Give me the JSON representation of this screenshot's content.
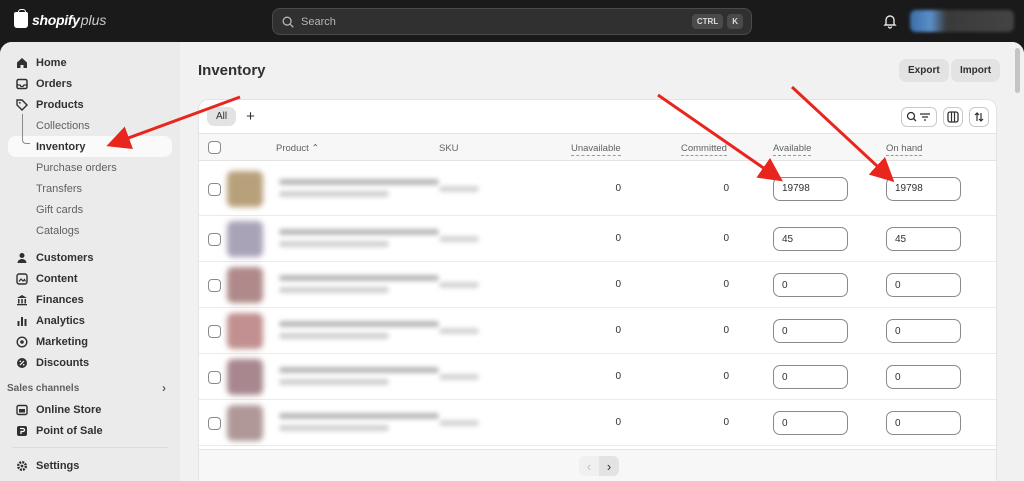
{
  "brand": {
    "name": "shopify",
    "suffix": "plus"
  },
  "search": {
    "placeholder": "Search",
    "shortcut": [
      "CTRL",
      "K"
    ]
  },
  "sidebar": {
    "items": [
      {
        "label": "Home",
        "icon": "home-icon"
      },
      {
        "label": "Orders",
        "icon": "inbox-icon"
      },
      {
        "label": "Products",
        "icon": "tag-icon"
      }
    ],
    "product_subitems": [
      "Collections",
      "Inventory",
      "Purchase orders",
      "Transfers",
      "Gift cards",
      "Catalogs"
    ],
    "active_subitem": "Inventory",
    "items2": [
      {
        "label": "Customers",
        "icon": "person-icon"
      },
      {
        "label": "Content",
        "icon": "content-icon"
      },
      {
        "label": "Finances",
        "icon": "bank-icon"
      },
      {
        "label": "Analytics",
        "icon": "chart-icon"
      },
      {
        "label": "Marketing",
        "icon": "target-icon"
      },
      {
        "label": "Discounts",
        "icon": "discount-icon"
      }
    ],
    "sales_channels_label": "Sales channels",
    "channels": [
      {
        "label": "Online Store",
        "icon": "store-icon"
      },
      {
        "label": "Point of Sale",
        "icon": "pos-icon"
      }
    ],
    "settings_label": "Settings"
  },
  "page": {
    "title": "Inventory",
    "export_label": "Export",
    "import_label": "Import"
  },
  "tabs": {
    "all_label": "All",
    "add_label": "+"
  },
  "table": {
    "headers": {
      "product": "Product",
      "sku": "SKU",
      "unavailable": "Unavailable",
      "committed": "Committed",
      "available": "Available",
      "on_hand": "On hand"
    },
    "rows": [
      {
        "unavailable": "0",
        "committed": "0",
        "available": "19798",
        "on_hand": "19798",
        "thumb": "#b8a07a"
      },
      {
        "unavailable": "0",
        "committed": "0",
        "available": "45",
        "on_hand": "45",
        "thumb": "#a9a3b8"
      },
      {
        "unavailable": "0",
        "committed": "0",
        "available": "0",
        "on_hand": "0",
        "thumb": "#b08a8a"
      },
      {
        "unavailable": "0",
        "committed": "0",
        "available": "0",
        "on_hand": "0",
        "thumb": "#c29090"
      },
      {
        "unavailable": "0",
        "committed": "0",
        "available": "0",
        "on_hand": "0",
        "thumb": "#a8888e"
      },
      {
        "unavailable": "0",
        "committed": "0",
        "available": "0",
        "on_hand": "0",
        "thumb": "#b09898"
      }
    ]
  },
  "colors": {
    "annotation_arrow": "#e8261e",
    "topbar": "#1a1a1a"
  }
}
